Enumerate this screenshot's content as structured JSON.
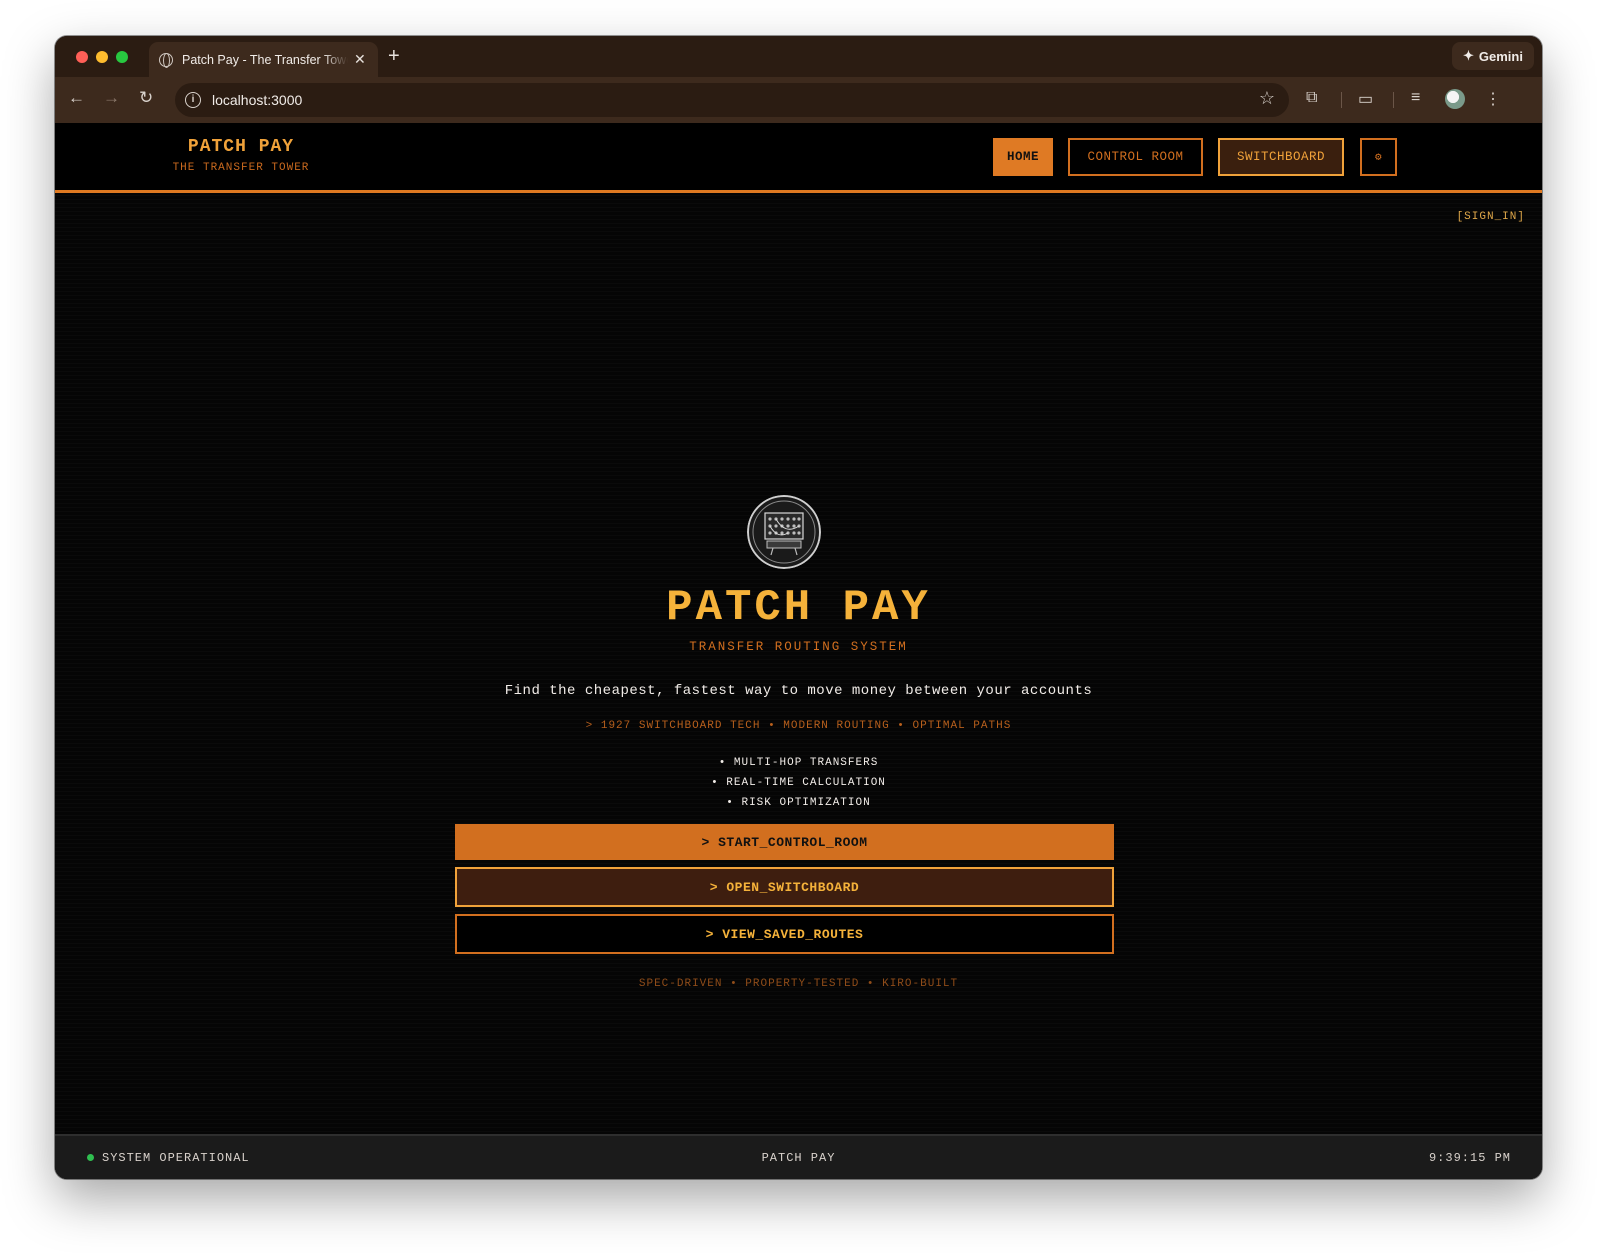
{
  "browser": {
    "tab_title": "Patch Pay - The Transfer Tower",
    "new_tab": "+",
    "close": "✕",
    "gemini_label": "Gemini",
    "url": "localhost:3000"
  },
  "header": {
    "brand_name": "PATCH PAY",
    "brand_sub": "THE TRANSFER TOWER",
    "nav": {
      "home": "HOME",
      "control_room": "CONTROL ROOM",
      "switchboard": "SWITCHBOARD",
      "settings": "⚙"
    }
  },
  "signin": "[SIGN_IN]",
  "hero": {
    "title": "PATCH PAY",
    "subtitle": "TRANSFER ROUTING SYSTEM",
    "description": "Find the cheapest, fastest way to move money between your accounts",
    "tagline": "> 1927 SWITCHBOARD TECH • MODERN ROUTING • OPTIMAL PATHS",
    "features": [
      "• MULTI-HOP TRANSFERS",
      "• REAL-TIME CALCULATION",
      "• RISK OPTIMIZATION"
    ],
    "buttons": {
      "start": "> START_CONTROL_ROOM",
      "open": "> OPEN_SWITCHBOARD",
      "saved": "> VIEW_SAVED_ROUTES"
    },
    "footer_tag": "SPEC-DRIVEN • PROPERTY-TESTED • KIRO-BUILT"
  },
  "statusbar": {
    "status": "SYSTEM OPERATIONAL",
    "center": "PATCH PAY",
    "time": "9:39:15 PM"
  },
  "colors": {
    "accent": "#df7a24",
    "gold": "#f5b23a",
    "status_ok": "#2fbf50",
    "background": "#050505"
  }
}
